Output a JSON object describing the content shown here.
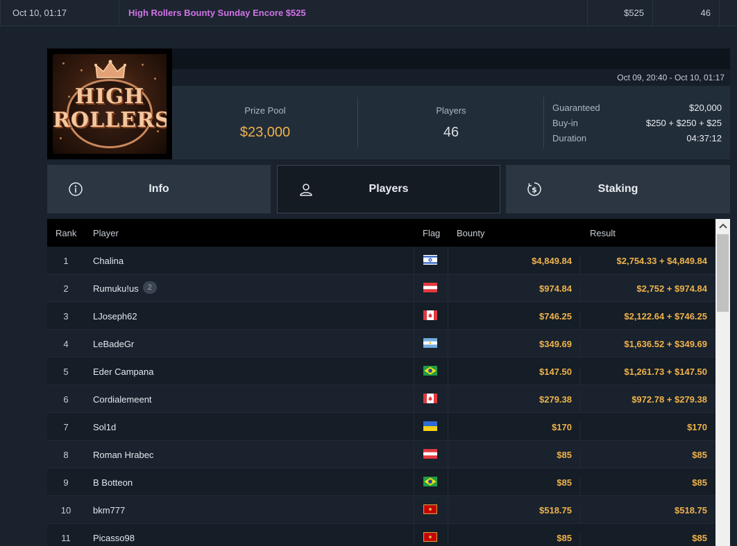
{
  "top_row": {
    "date": "Oct 10, 01:17",
    "name": "High Rollers Bounty Sunday Encore $525",
    "buyin": "$525",
    "count": "46"
  },
  "header": {
    "logo_text_1": "HIGH",
    "logo_text_2": "ROLLERS",
    "date_range": "Oct 09, 20:40 - Oct 10, 01:17",
    "prize_pool_label": "Prize Pool",
    "prize_pool_value": "$23,000",
    "players_label": "Players",
    "players_value": "46",
    "guaranteed_label": "Guaranteed",
    "guaranteed_value": "$20,000",
    "buyin_label": "Buy-in",
    "buyin_value": "$250 + $250 + $25",
    "duration_label": "Duration",
    "duration_value": "04:37:12"
  },
  "tabs": [
    {
      "label": "Info",
      "icon": "info-icon"
    },
    {
      "label": "Players",
      "icon": "user-icon"
    },
    {
      "label": "Staking",
      "icon": "dollar-coin-icon"
    }
  ],
  "table": {
    "headers": {
      "rank": "Rank",
      "player": "Player",
      "flag": "Flag",
      "bounty": "Bounty",
      "result": "Result"
    },
    "rows": [
      {
        "rank": "1",
        "player": "Chalina",
        "badge": "",
        "flag": "israel",
        "bounty": "$4,849.84",
        "result": "$2,754.33 + $4,849.84"
      },
      {
        "rank": "2",
        "player": "Rumuku!us",
        "badge": "2",
        "flag": "austria",
        "bounty": "$974.84",
        "result": "$2,752 + $974.84"
      },
      {
        "rank": "3",
        "player": "LJoseph62",
        "badge": "",
        "flag": "canada",
        "bounty": "$746.25",
        "result": "$2,122.64 + $746.25"
      },
      {
        "rank": "4",
        "player": "LeBadeGr",
        "badge": "",
        "flag": "argentina",
        "bounty": "$349.69",
        "result": "$1,636.52 + $349.69"
      },
      {
        "rank": "5",
        "player": "Eder Campana",
        "badge": "",
        "flag": "brazil",
        "bounty": "$147.50",
        "result": "$1,261.73 + $147.50"
      },
      {
        "rank": "6",
        "player": "Cordialemeent",
        "badge": "",
        "flag": "canada",
        "bounty": "$279.38",
        "result": "$972.78 + $279.38"
      },
      {
        "rank": "7",
        "player": "Sol1d",
        "badge": "",
        "flag": "ukraine",
        "bounty": "$170",
        "result": "$170"
      },
      {
        "rank": "8",
        "player": "Roman Hrabec",
        "badge": "",
        "flag": "austria",
        "bounty": "$85",
        "result": "$85"
      },
      {
        "rank": "9",
        "player": "B Botteon",
        "badge": "",
        "flag": "brazil",
        "bounty": "$85",
        "result": "$85"
      },
      {
        "rank": "10",
        "player": "bkm777",
        "badge": "",
        "flag": "montenegro",
        "bounty": "$518.75",
        "result": "$518.75"
      },
      {
        "rank": "11",
        "player": "Picasso98",
        "badge": "",
        "flag": "montenegro",
        "bounty": "$85",
        "result": "$85"
      }
    ]
  },
  "colors": {
    "accent_gold": "#f0b24a",
    "accent_purple": "#d173e6",
    "background": "#19222d"
  }
}
